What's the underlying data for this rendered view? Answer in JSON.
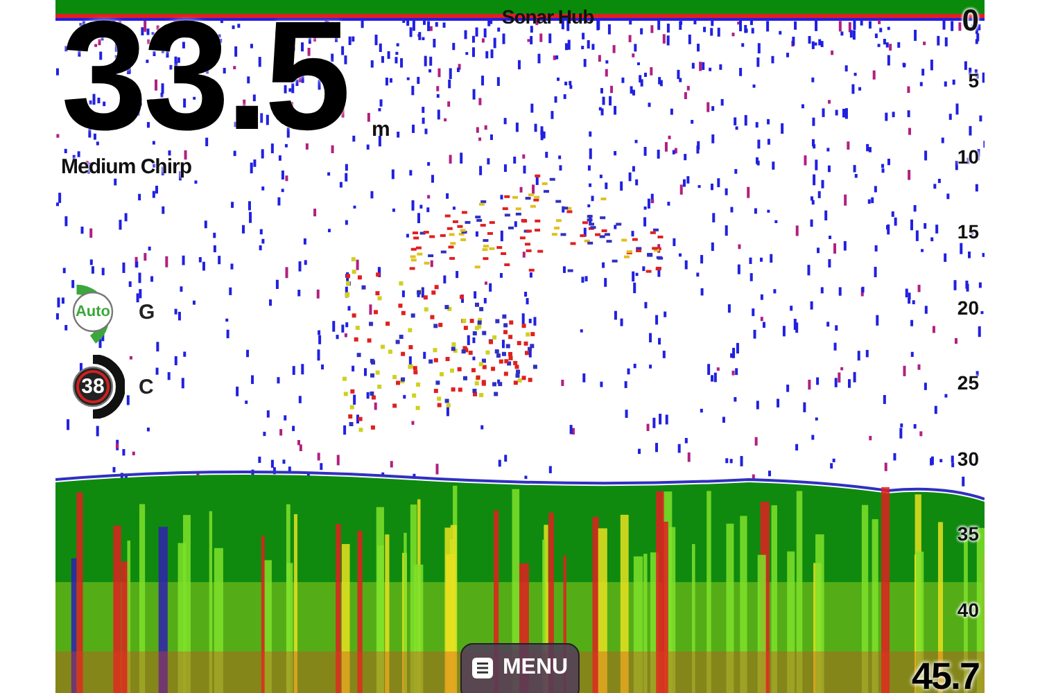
{
  "title": "Sonar Hub",
  "depth": {
    "value": "33.5",
    "unit": "m"
  },
  "mode": "Medium Chirp",
  "gauges": [
    {
      "kind": "auto",
      "value": "Auto",
      "label": "G"
    },
    {
      "kind": "number",
      "value": "38",
      "label": "C"
    }
  ],
  "scale": [
    "0",
    "5",
    "10",
    "15",
    "20",
    "25",
    "30",
    "35",
    "40"
  ],
  "range_end": "45.7",
  "menu_button": {
    "label": "MENU"
  }
}
